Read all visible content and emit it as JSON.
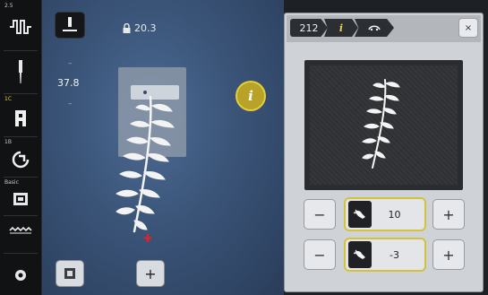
{
  "sidebar": {
    "items": [
      {
        "tag": "2.5",
        "icon": "stitch-width-icon"
      },
      {
        "tag": "",
        "icon": "needle-icon"
      },
      {
        "tag": "1C",
        "icon": "presser-foot-icon"
      },
      {
        "tag": "1B",
        "icon": "thread-tension-icon"
      },
      {
        "tag": "Basic",
        "icon": "basic-settings-icon"
      },
      {
        "tag": "",
        "icon": "feed-dog-icon"
      },
      {
        "tag": "",
        "icon": "settings-gear-icon"
      }
    ]
  },
  "canvas": {
    "lock_value": "20.3",
    "left_value": "37.8",
    "dash_top": "–",
    "dash_bottom": "–",
    "plus_label": "+"
  },
  "panel": {
    "crumbs": [
      {
        "label": "212"
      },
      {
        "label": "i"
      },
      {
        "label": "☍"
      }
    ],
    "close_label": "×",
    "controls": [
      {
        "minus": "−",
        "value": "10",
        "plus": "+"
      },
      {
        "minus": "−",
        "value": "-3",
        "plus": "+"
      }
    ]
  },
  "colors": {
    "accent": "#d4c23a",
    "info_button": "#b8a328",
    "canvas": "#3a5478",
    "marker": "#e2222a"
  }
}
